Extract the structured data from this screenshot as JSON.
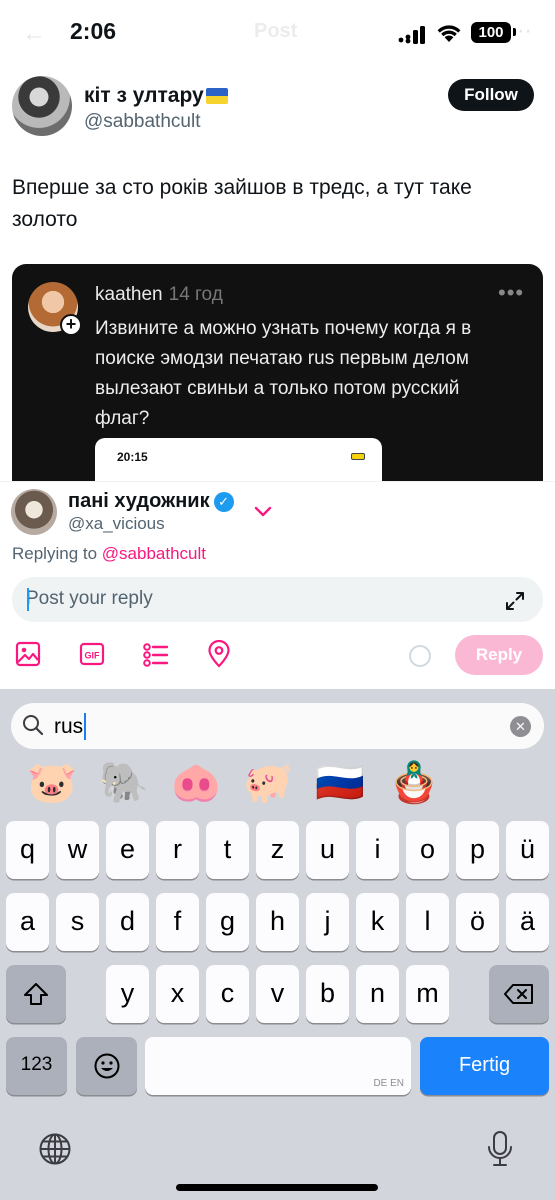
{
  "status": {
    "time": "2:06",
    "battery": "100"
  },
  "nav_ghost": {
    "back": "←",
    "title": "Post",
    "more": "⋯"
  },
  "post": {
    "author_name": "кіт з ултару",
    "author_handle": "@sabbathcult",
    "follow_label": "Follow",
    "text": "Вперше за сто років зайшов в тредс, а тут таке золото"
  },
  "embed": {
    "user": "kaathen",
    "time": "14 год",
    "text": "Извините а можно узнать почему когда я в поиске эмодзи печатаю rus первым делом вылезают свиньи а только потом русский флаг?",
    "phone_time": "20:15"
  },
  "composer": {
    "name": "пані художник",
    "handle": "@xa_vicious",
    "replying_prefix": "Replying to",
    "replying_handle": "@sabbathcult",
    "placeholder": "Post your reply",
    "reply_label": "Reply",
    "tool_icons": [
      "image-icon",
      "gif-icon",
      "poll-icon",
      "location-icon"
    ],
    "accent_color": "#f91880"
  },
  "keyboard": {
    "search_text": "rus",
    "emoji_results": [
      "🐷",
      "🐘",
      "🐽",
      "🐖",
      "🇷🇺",
      "🪆"
    ],
    "rows": [
      [
        "q",
        "w",
        "e",
        "r",
        "t",
        "z",
        "u",
        "i",
        "o",
        "p",
        "ü"
      ],
      [
        "a",
        "s",
        "d",
        "f",
        "g",
        "h",
        "j",
        "k",
        "l",
        "ö",
        "ä"
      ],
      [
        "y",
        "x",
        "c",
        "v",
        "b",
        "n",
        "m"
      ]
    ],
    "numbers_label": "123",
    "space_lang": "DE EN",
    "return_label": "Fertig"
  }
}
